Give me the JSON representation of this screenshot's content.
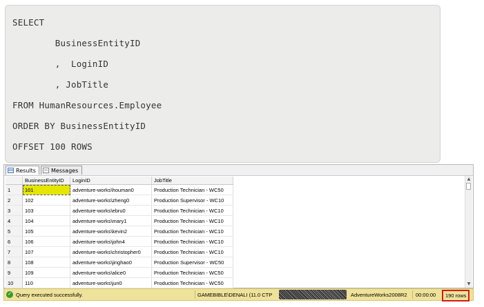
{
  "editor": {
    "lines": [
      "SELECT",
      "        BusinessEntityID",
      "        ,  LoginID",
      "        , JobTitle",
      "FROM HumanResources.Employee",
      "ORDER BY BusinessEntityID",
      "OFFSET 100 ROWS"
    ]
  },
  "tabs": {
    "results_label": "Results",
    "messages_label": "Messages"
  },
  "grid": {
    "columns": [
      "BusinessEntityID",
      "LoginID",
      "JobTitle"
    ],
    "rows": [
      {
        "n": "1",
        "id": "101",
        "login": "adventure-works\\houman0",
        "title": "Production Technician - WC50"
      },
      {
        "n": "2",
        "id": "102",
        "login": "adventure-works\\zheng0",
        "title": "Production Supervisor - WC10"
      },
      {
        "n": "3",
        "id": "103",
        "login": "adventure-works\\ebru0",
        "title": "Production Technician - WC10"
      },
      {
        "n": "4",
        "id": "104",
        "login": "adventure-works\\mary1",
        "title": "Production Technician - WC10"
      },
      {
        "n": "5",
        "id": "105",
        "login": "adventure-works\\kevin2",
        "title": "Production Technician - WC10"
      },
      {
        "n": "6",
        "id": "106",
        "login": "adventure-works\\john4",
        "title": "Production Technician - WC10"
      },
      {
        "n": "7",
        "id": "107",
        "login": "adventure-works\\christopher0",
        "title": "Production Technician - WC10"
      },
      {
        "n": "8",
        "id": "108",
        "login": "adventure-works\\jinghao0",
        "title": "Production Supervisor - WC50"
      },
      {
        "n": "9",
        "id": "109",
        "login": "adventure-works\\alice0",
        "title": "Production Technician - WC50"
      },
      {
        "n": "10",
        "id": "110",
        "login": "adventure-works\\jun0",
        "title": "Production Technician - WC50"
      }
    ]
  },
  "status": {
    "message": "Query executed successfully.",
    "server": "GAMEBIBLE\\DENALI (11.0 CTP",
    "database": "AdventureWorks2008R2",
    "elapsed": "00:00:00",
    "rows": "190 rows",
    "colors": {
      "bar": "#efe29a",
      "rows_border": "#d71818",
      "selection": "#e5e500"
    }
  }
}
